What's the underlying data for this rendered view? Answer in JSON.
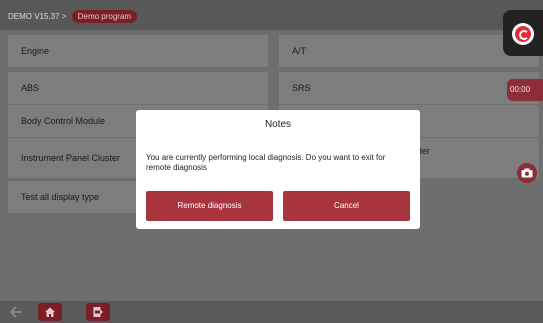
{
  "breadcrumb": {
    "version": "DEMO V15.37 >",
    "demo_label": "Demo program"
  },
  "systems": [
    {
      "label": "Engine"
    },
    {
      "label": "A/T"
    },
    {
      "label": "ABS"
    },
    {
      "label": "SRS"
    },
    {
      "label": "Body Control Module"
    },
    {
      "label": ""
    },
    {
      "label": "Instrument Panel Cluster"
    },
    {
      "label": "ontrol Module Vehicle Theft cluster"
    },
    {
      "label": "Test all display type"
    }
  ],
  "recorder": {
    "time": "00:00"
  },
  "dialog": {
    "title": "Notes",
    "message": "You are currently performing local diagnosis. Do you want to exit for remote diagnosis",
    "remote_button": "Remote diagnosis",
    "cancel_button": "Cancel"
  },
  "colors": {
    "accent": "#a8343e",
    "dark_accent": "#7a1f28"
  },
  "icons": [
    "back-icon",
    "home-icon",
    "exit-icon",
    "camera-icon",
    "app-logo-icon"
  ]
}
